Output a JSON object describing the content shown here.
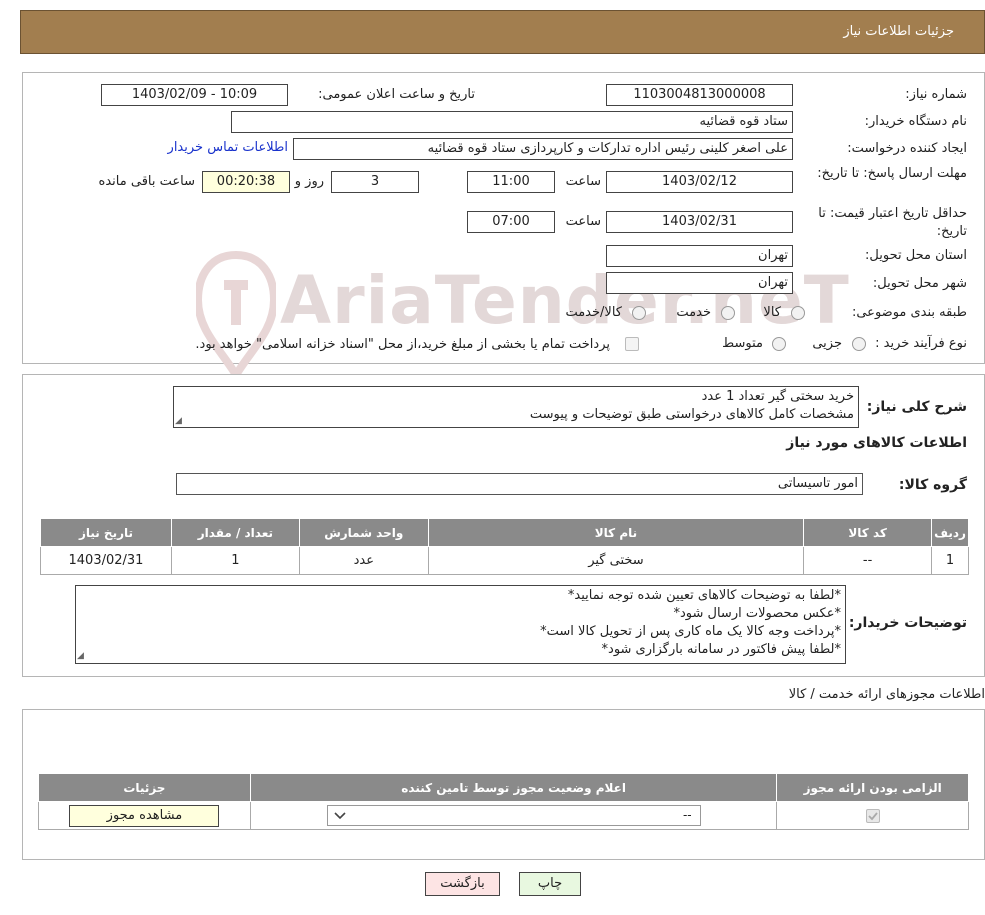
{
  "header": {
    "title": "جزئیات اطلاعات نیاز"
  },
  "watermark": "AriaTender.neT",
  "labels": {
    "need_number": "شماره نیاز:",
    "announce_datetime": "تاریخ و ساعت اعلان عمومی:",
    "buyer_org": "نام دستگاه خریدار:",
    "requester": "ایجاد کننده درخواست:",
    "reply_deadline": "مهلت ارسال پاسخ: تا تاریخ:",
    "price_validity": "حداقل تاریخ اعتبار قیمت: تا تاریخ:",
    "time": "ساعت",
    "day_and": "روز و",
    "remaining": "ساعت باقی مانده",
    "province": "استان محل تحویل:",
    "city": "شهر محل تحویل:",
    "category": "طبقه بندی موضوعی:",
    "purchase_type": "نوع فرآیند خرید :"
  },
  "values": {
    "need_number": "1103004813000008",
    "announce_datetime": "1403/02/09 - 10:09",
    "buyer_org": "ستاد قوه قضائیه",
    "requester": "علی اصغر کلینی رئیس اداره تدارکات و کارپردازی ستاد قوه قضائیه",
    "contact_link": "اطلاعات تماس خریدار",
    "reply_date": "1403/02/12",
    "reply_time": "11:00",
    "days": "3",
    "remaining_time": "00:20:38",
    "validity_date": "1403/02/31",
    "validity_time": "07:00",
    "province": "تهران",
    "city": "تهران"
  },
  "category_options": [
    "کالا",
    "خدمت",
    "کالا/خدمت"
  ],
  "purchase_options": [
    "جزیی",
    "متوسط"
  ],
  "purchase_note": "پرداخت تمام یا بخشی از مبلغ خرید،از محل \"اسناد خزانه اسلامی\" خواهد بود.",
  "summary": {
    "label": "شرح کلی نیاز:",
    "line1": "خرید سختی گیر تعداد 1 عدد",
    "line2": "مشخصات کامل کالاهای درخواستی طبق توضیحات و پیوست"
  },
  "items_section": {
    "title": "اطلاعات کالاهای مورد نیاز",
    "group_label": "گروه کالا:",
    "group_value": "امور تاسیساتی",
    "columns": [
      "ردیف",
      "کد کالا",
      "نام کالا",
      "واحد شمارش",
      "تعداد / مقدار",
      "تاریخ نیاز"
    ],
    "rows": [
      {
        "row": "1",
        "code": "--",
        "name": "سختی گیر",
        "unit": "عدد",
        "qty": "1",
        "date": "1403/02/31"
      }
    ]
  },
  "buyer_notes": {
    "label": "توضیحات خریدار:",
    "lines": [
      "*لطفا به توضیحات کالاهای تعیین شده توجه نمایید*",
      "*عکس محصولات ارسال شود*",
      "*پرداخت وجه کالا یک ماه کاری پس از تحویل کالا است*",
      "*لطفا پیش فاکتور در سامانه بارگزاری شود*"
    ]
  },
  "permits": {
    "title": "اطلاعات مجوزهای ارائه خدمت / کالا",
    "columns": [
      "الزامی بودن ارائه مجوز",
      "اعلام وضعیت مجوز توسط تامین کننده",
      "جزئیات"
    ],
    "select_value": "--",
    "view_button": "مشاهده مجوز"
  },
  "buttons": {
    "print": "چاپ",
    "back": "بازگشت"
  }
}
